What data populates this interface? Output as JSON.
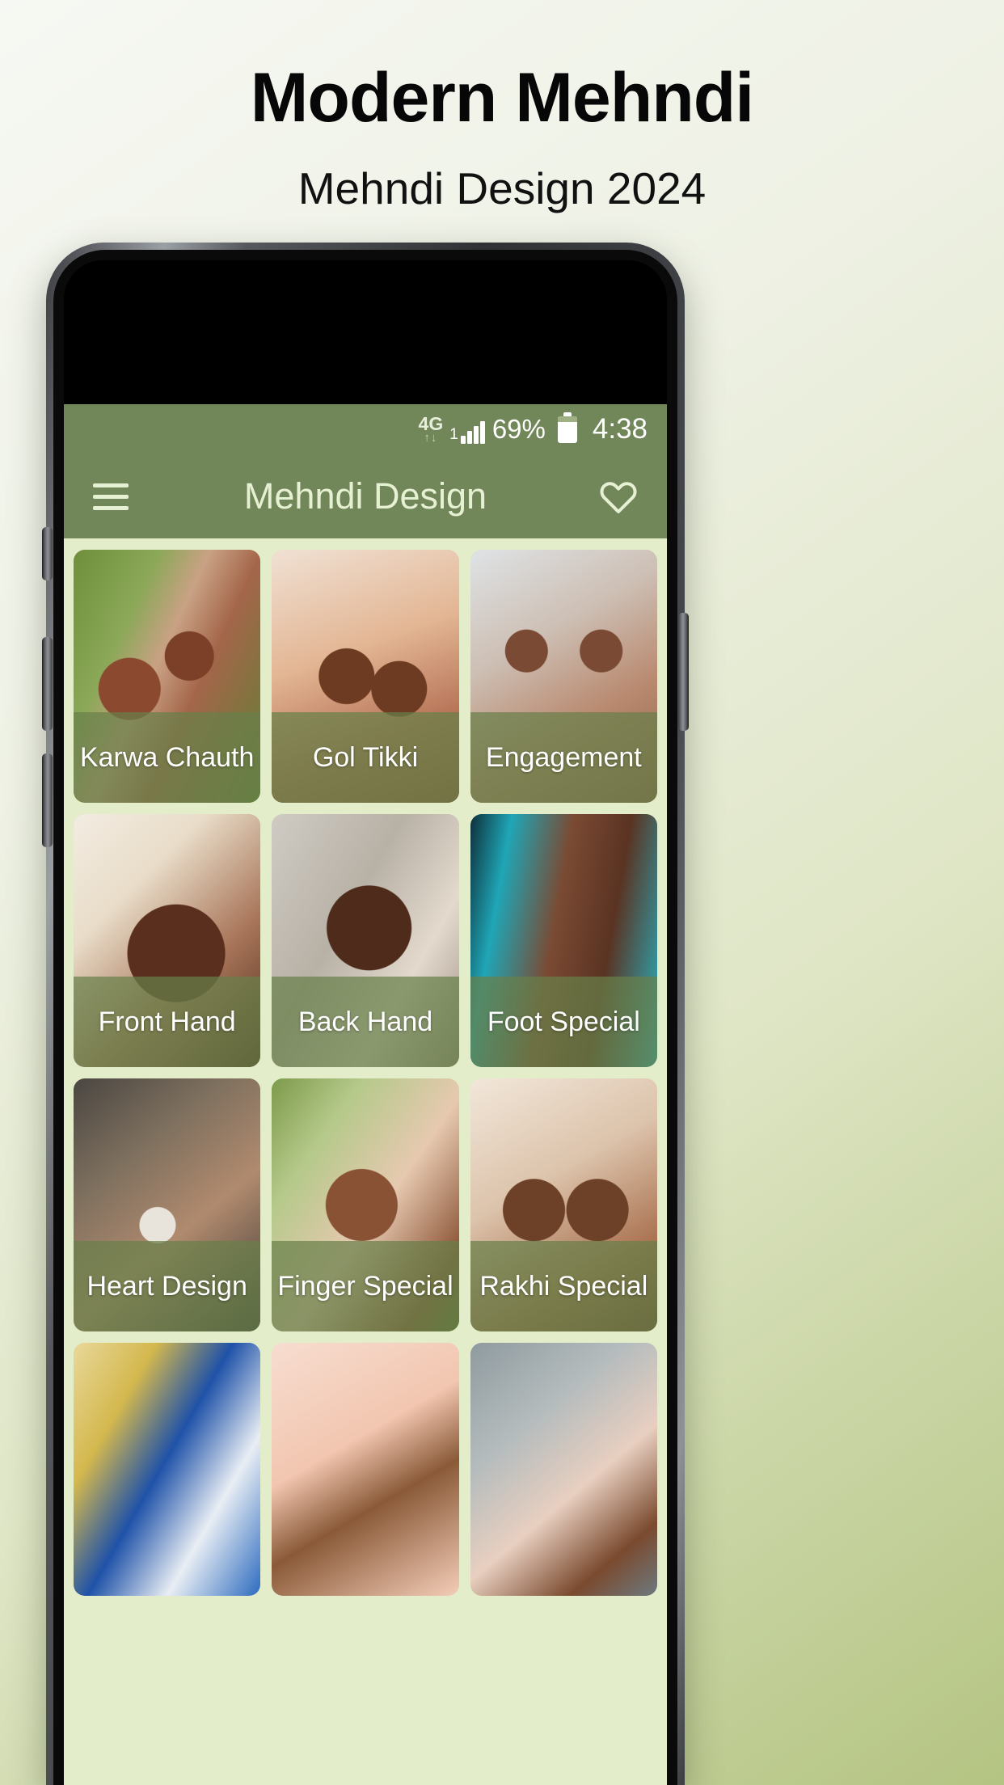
{
  "promo": {
    "title": "Modern Mehndi",
    "subtitle": "Mehndi Design 2024"
  },
  "colors": {
    "app_bar": "#718659",
    "status_bar": "#718659",
    "app_background": "#e4edca",
    "label_band": "rgba(104,127,74,0.72)",
    "title_text": "#e6f0d2",
    "page_gradient_start": "#f6f8f3",
    "page_gradient_end": "#b4c482"
  },
  "status_bar": {
    "network_label": "4G",
    "network_arrows": "↑↓",
    "signal_label": "1",
    "battery_percent": "69%",
    "clock": "4:38"
  },
  "app_bar": {
    "menu_icon": "hamburger-menu-icon",
    "title": "Mehndi Design",
    "favorite_icon": "heart-outline-icon"
  },
  "grid": {
    "tiles": [
      {
        "label": "Karwa Chauth",
        "art": "a1"
      },
      {
        "label": "Gol Tikki",
        "art": "a2"
      },
      {
        "label": "Engagement",
        "art": "a3"
      },
      {
        "label": "Front Hand",
        "art": "a4"
      },
      {
        "label": "Back Hand",
        "art": "a5"
      },
      {
        "label": "Foot Special",
        "art": "a6"
      },
      {
        "label": "Heart Design",
        "art": "a7"
      },
      {
        "label": "Finger Special",
        "art": "a8"
      },
      {
        "label": "Rakhi Special",
        "art": "a9"
      },
      {
        "label": "",
        "art": "a10"
      },
      {
        "label": "",
        "art": "a11"
      },
      {
        "label": "",
        "art": "a12"
      }
    ]
  },
  "device": {
    "camera_icon": "front-camera-icon",
    "earpiece_icon": "earpiece-speaker-icon",
    "buttons": [
      "silent-switch",
      "volume-up-button",
      "volume-down-button",
      "power-button"
    ]
  }
}
